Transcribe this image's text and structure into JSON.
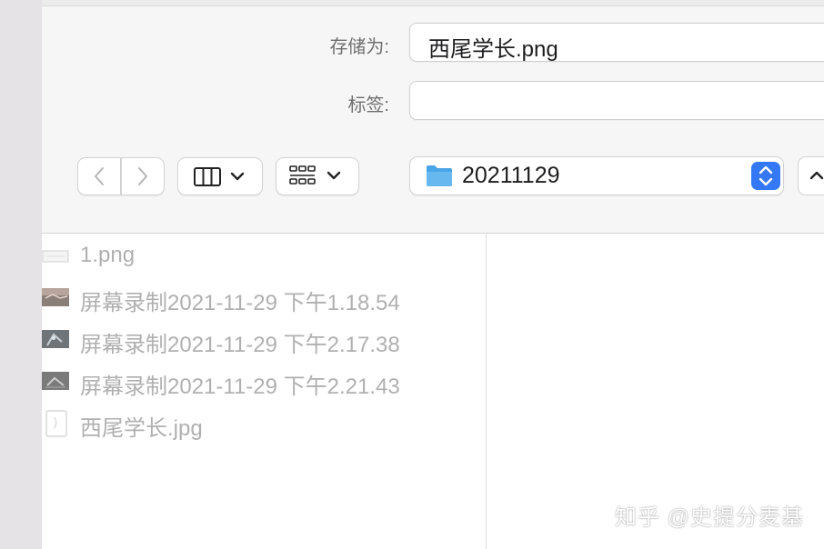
{
  "save_form": {
    "save_as_label": "存储为:",
    "save_as_value": "西尾学长.png",
    "tags_label": "标签:",
    "tags_value": ""
  },
  "toolbar": {
    "back_icon": "chevron-left-icon",
    "forward_icon": "chevron-right-icon",
    "column_view_icon": "column-view-icon",
    "icon_view_icon": "grid-view-icon",
    "location_folder": "20211129",
    "accent_color": "#3478f6",
    "folder_color": "#4aa4e8"
  },
  "file_list": {
    "items": [
      {
        "name": "1.png",
        "icon": "image-file-icon"
      },
      {
        "name": "屏幕录制2021-11-29 下午1.18.54",
        "icon": "video-thumbnail-icon"
      },
      {
        "name": "屏幕录制2021-11-29 下午2.17.38",
        "icon": "video-thumbnail-icon"
      },
      {
        "name": "屏幕录制2021-11-29 下午2.21.43",
        "icon": "video-thumbnail-icon"
      },
      {
        "name": "西尾学长.jpg",
        "icon": "document-file-icon"
      }
    ]
  },
  "watermark": "知乎 @史提分麦基"
}
